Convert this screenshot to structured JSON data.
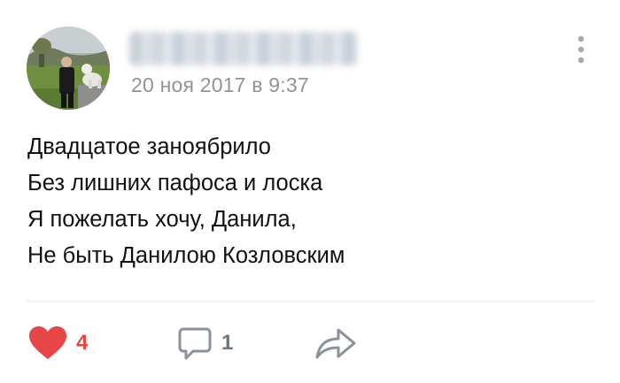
{
  "post": {
    "author": {
      "avatar_icon": "avatar-photo",
      "name_blurred": true
    },
    "date": "20 ноя 2017 в 9:37",
    "text_lines": [
      "Двадцатое заноябрило",
      "Без лишних пафоса и лоска",
      "Я пожелать хочу, Данила,",
      "Не быть Данилою Козловским"
    ],
    "actions": {
      "like": {
        "icon": "heart-icon",
        "count": "4",
        "active": true
      },
      "comment": {
        "icon": "comment-icon",
        "count": "1"
      },
      "share": {
        "icon": "share-icon"
      }
    }
  },
  "colors": {
    "like_active": "#e64646",
    "meta_gray": "#8d949c",
    "icon_gray": "#8a929b",
    "divider": "#e5e8ec"
  }
}
